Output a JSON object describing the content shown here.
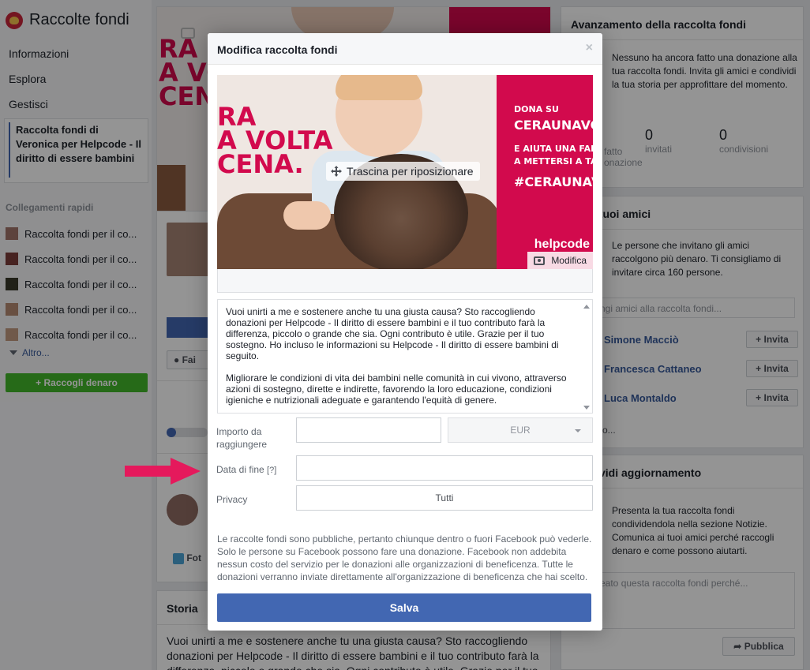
{
  "sidebar": {
    "title": "Raccolte fondi",
    "nav": [
      "Informazioni",
      "Esplora",
      "Gestisci"
    ],
    "selected": "Raccolta fondi di Veronica per Helpcode - Il diritto di essere bambini",
    "quick_links_heading": "Collegamenti rapidi",
    "quick_links": [
      "Raccolta fondi per il co...",
      "Raccolta fondi per il co...",
      "Raccolta fondi per il co...",
      "Raccolta fondi per il co...",
      "Raccolta fondi per il co..."
    ],
    "more": "Altro...",
    "cta": "Raccogli denaro"
  },
  "center": {
    "cover_text": "RA\nA VOLTA\nCENA.",
    "fai_button": "Fai",
    "foto_button": "Fot",
    "storia_heading": "Storia",
    "storia_text": "Vuoi unirti a me e sostenere anche tu una giusta causa? Sto raccogliendo donazioni per Helpcode - Il diritto di essere bambini e il tuo contributo farà la differenza, piccolo o grande che sia. Ogni contributo è utile. Grazie per il tuo"
  },
  "right": {
    "progress_heading": "Avanzamento della raccolta fondi",
    "progress_text": "Nessuno ha ancora fatto una donazione alla tua raccolta fondi. Invita gli amici e condividi la tua storia per approfittare del momento.",
    "stats": [
      {
        "num": "",
        "label": "fatto\nonazione"
      },
      {
        "num": "0",
        "label": "invitati"
      },
      {
        "num": "0",
        "label": "condivisioni"
      }
    ],
    "friends_heading": "i tuoi amici",
    "friends_text": "Le persone che invitano gli amici raccolgono più denaro. Ti consigliamo di invitare circa 160 persone.",
    "friends_search_placeholder": "ngi amici alla raccolta fondi...",
    "friends": [
      "Simone Macciò",
      "Francesca Cattaneo",
      "Luca Montaldo"
    ],
    "invite_label": "Invita",
    "more_text": "o...",
    "share_heading": "vidi aggiornamento",
    "share_text": "Presenta la tua raccolta fondi condividendola nella sezione Notizie. Comunica ai tuoi amici perché raccogli denaro e come possono aiutarti.",
    "share_placeholder": "eato questa raccolta fondi perché...",
    "publish": "Pubblica"
  },
  "modal": {
    "title": "Modifica raccolta fondi",
    "close": "×",
    "cover": {
      "headline": "RA\nA VOLTA\nCENA.",
      "panel_line1": "DONA SU",
      "panel_line2": "CERAUNAVOLTA",
      "panel_line3": "E AIUTA UNA FAMIGLIA",
      "panel_line4": "A METTERSI A TAVOLA C",
      "panel_tag": "#CERAUNAVOLT",
      "brand": "helpcode",
      "drag_label": "Trascina per riposizionare",
      "edit_label": "Modifica"
    },
    "description_p1": "Vuoi unirti a me e sostenere anche tu una giusta causa? Sto raccogliendo donazioni per Helpcode - Il diritto di essere bambini e il tuo contributo farà la differenza, piccolo o grande che sia. Ogni contributo è utile. Grazie per il tuo sostegno. Ho incluso le informazioni su Helpcode - Il diritto di essere bambini di seguito.",
    "description_p2": "Migliorare le condizioni di vita dei bambini nelle comunità in cui vivono, attraverso azioni di sostegno, dirette e indirette, favorendo la loro educazione, condizioni igieniche e nutrizionali adeguate e garantendo l'equità di genere.",
    "form": {
      "amount_label": "Importo da raggiungere",
      "amount_value": "",
      "currency": "EUR",
      "end_date_label": "Data di fine",
      "end_date_help": "[?]",
      "end_date_value": "",
      "privacy_label": "Privacy",
      "privacy_value": "Tutti"
    },
    "footer_text": "Le raccolte fondi sono pubbliche, pertanto chiunque dentro o fuori Facebook può vederle. Solo le persone su Facebook possono fare una donazione. Facebook non addebita nessun costo del servizio per le donazioni alle organizzazioni di beneficenza. Tutte le donazioni verranno inviate direttamente all'organizzazione di beneficenza che hai scelto.",
    "save": "Salva"
  },
  "colors": {
    "brand_blue": "#4267b2",
    "cta_green": "#42b72a",
    "campaign_pink": "#d20a4d",
    "annotation_arrow": "#e5195c"
  },
  "icons": [
    "move-icon",
    "camera-icon",
    "plus-icon",
    "share-icon",
    "chevron-down-icon"
  ]
}
